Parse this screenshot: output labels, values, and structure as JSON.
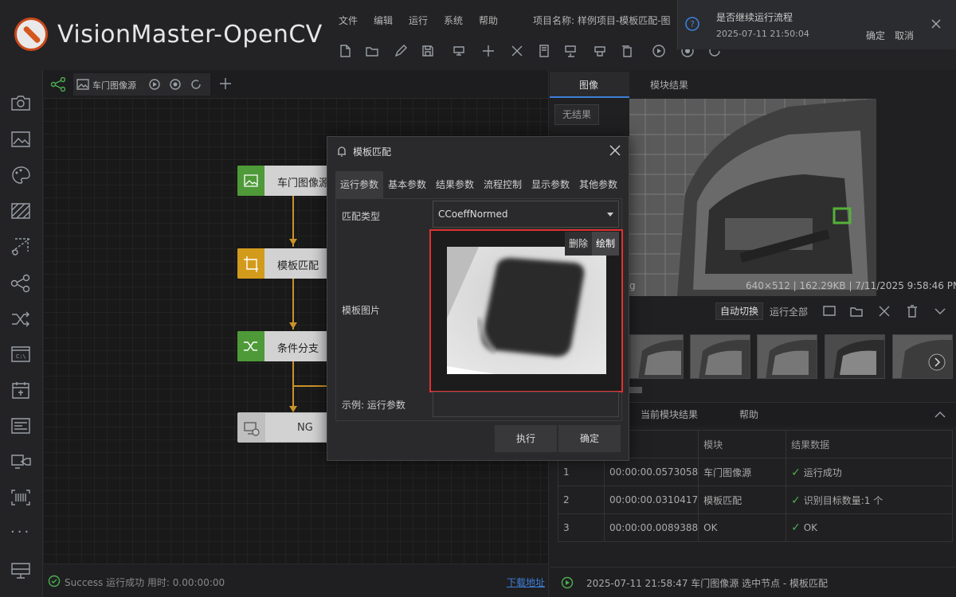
{
  "app": {
    "title": "VisionMaster-OpenCV"
  },
  "menu": [
    "文件",
    "编辑",
    "运行",
    "系统",
    "帮助"
  ],
  "project_label": "项目名称: 样例项目-模板匹配-图",
  "notification": {
    "title": "是否继续运行流程",
    "time": "2025-07-11 21:50:04",
    "ok": "确定",
    "cancel": "取消"
  },
  "canvas": {
    "tab_label": "车门图像源",
    "nodes": [
      {
        "label": "车门图像源",
        "color": "#4e9a38"
      },
      {
        "label": "模板匹配",
        "color": "#d39b1c"
      },
      {
        "label": "条件分支",
        "color": "#4e9a38"
      },
      {
        "label": "NG",
        "color": "#bfbfbf"
      }
    ]
  },
  "status": {
    "text": "Success 运行成功 用时: 0.00:00:00",
    "link": "下载地址"
  },
  "dialog": {
    "title": "模板匹配",
    "tabs": [
      "运行参数",
      "基本参数",
      "结果参数",
      "流程控制",
      "显示参数",
      "其他参数"
    ],
    "match_type_label": "匹配类型",
    "match_type_value": "CCoeffNormed",
    "template_label": "模板图片",
    "delete": "删除",
    "draw": "绘制",
    "example_label": "示例: 运行参数",
    "execute": "执行",
    "confirm": "确定"
  },
  "right": {
    "tabs": [
      "图像",
      "模块结果"
    ],
    "no_result": "无结果",
    "image_info": "640×512 | 162.29KB | 7/11/2025 9:58:46 PM",
    "image_info_left": "g",
    "auto_switch": "自动切换",
    "run_all": "运行全部",
    "result_tabs": [
      "当前模块结果",
      "帮助"
    ],
    "table": {
      "headers": [
        "",
        "时间",
        "模块",
        "结果数据"
      ],
      "rows": [
        [
          "1",
          "00:00:00.0573058",
          "车门图像源",
          "运行成功"
        ],
        [
          "2",
          "00:00:00.0310417",
          "模板匹配",
          "识别目标数量:1 个"
        ],
        [
          "3",
          "00:00:00.0089388",
          "OK",
          "OK"
        ]
      ]
    },
    "log": "2025-07-11 21:58:47  车门图像源 选中节点 - 模板匹配"
  },
  "colors": {
    "accent": "#3d7fd9",
    "highlight": "#e0312e",
    "success": "#4caf50"
  }
}
